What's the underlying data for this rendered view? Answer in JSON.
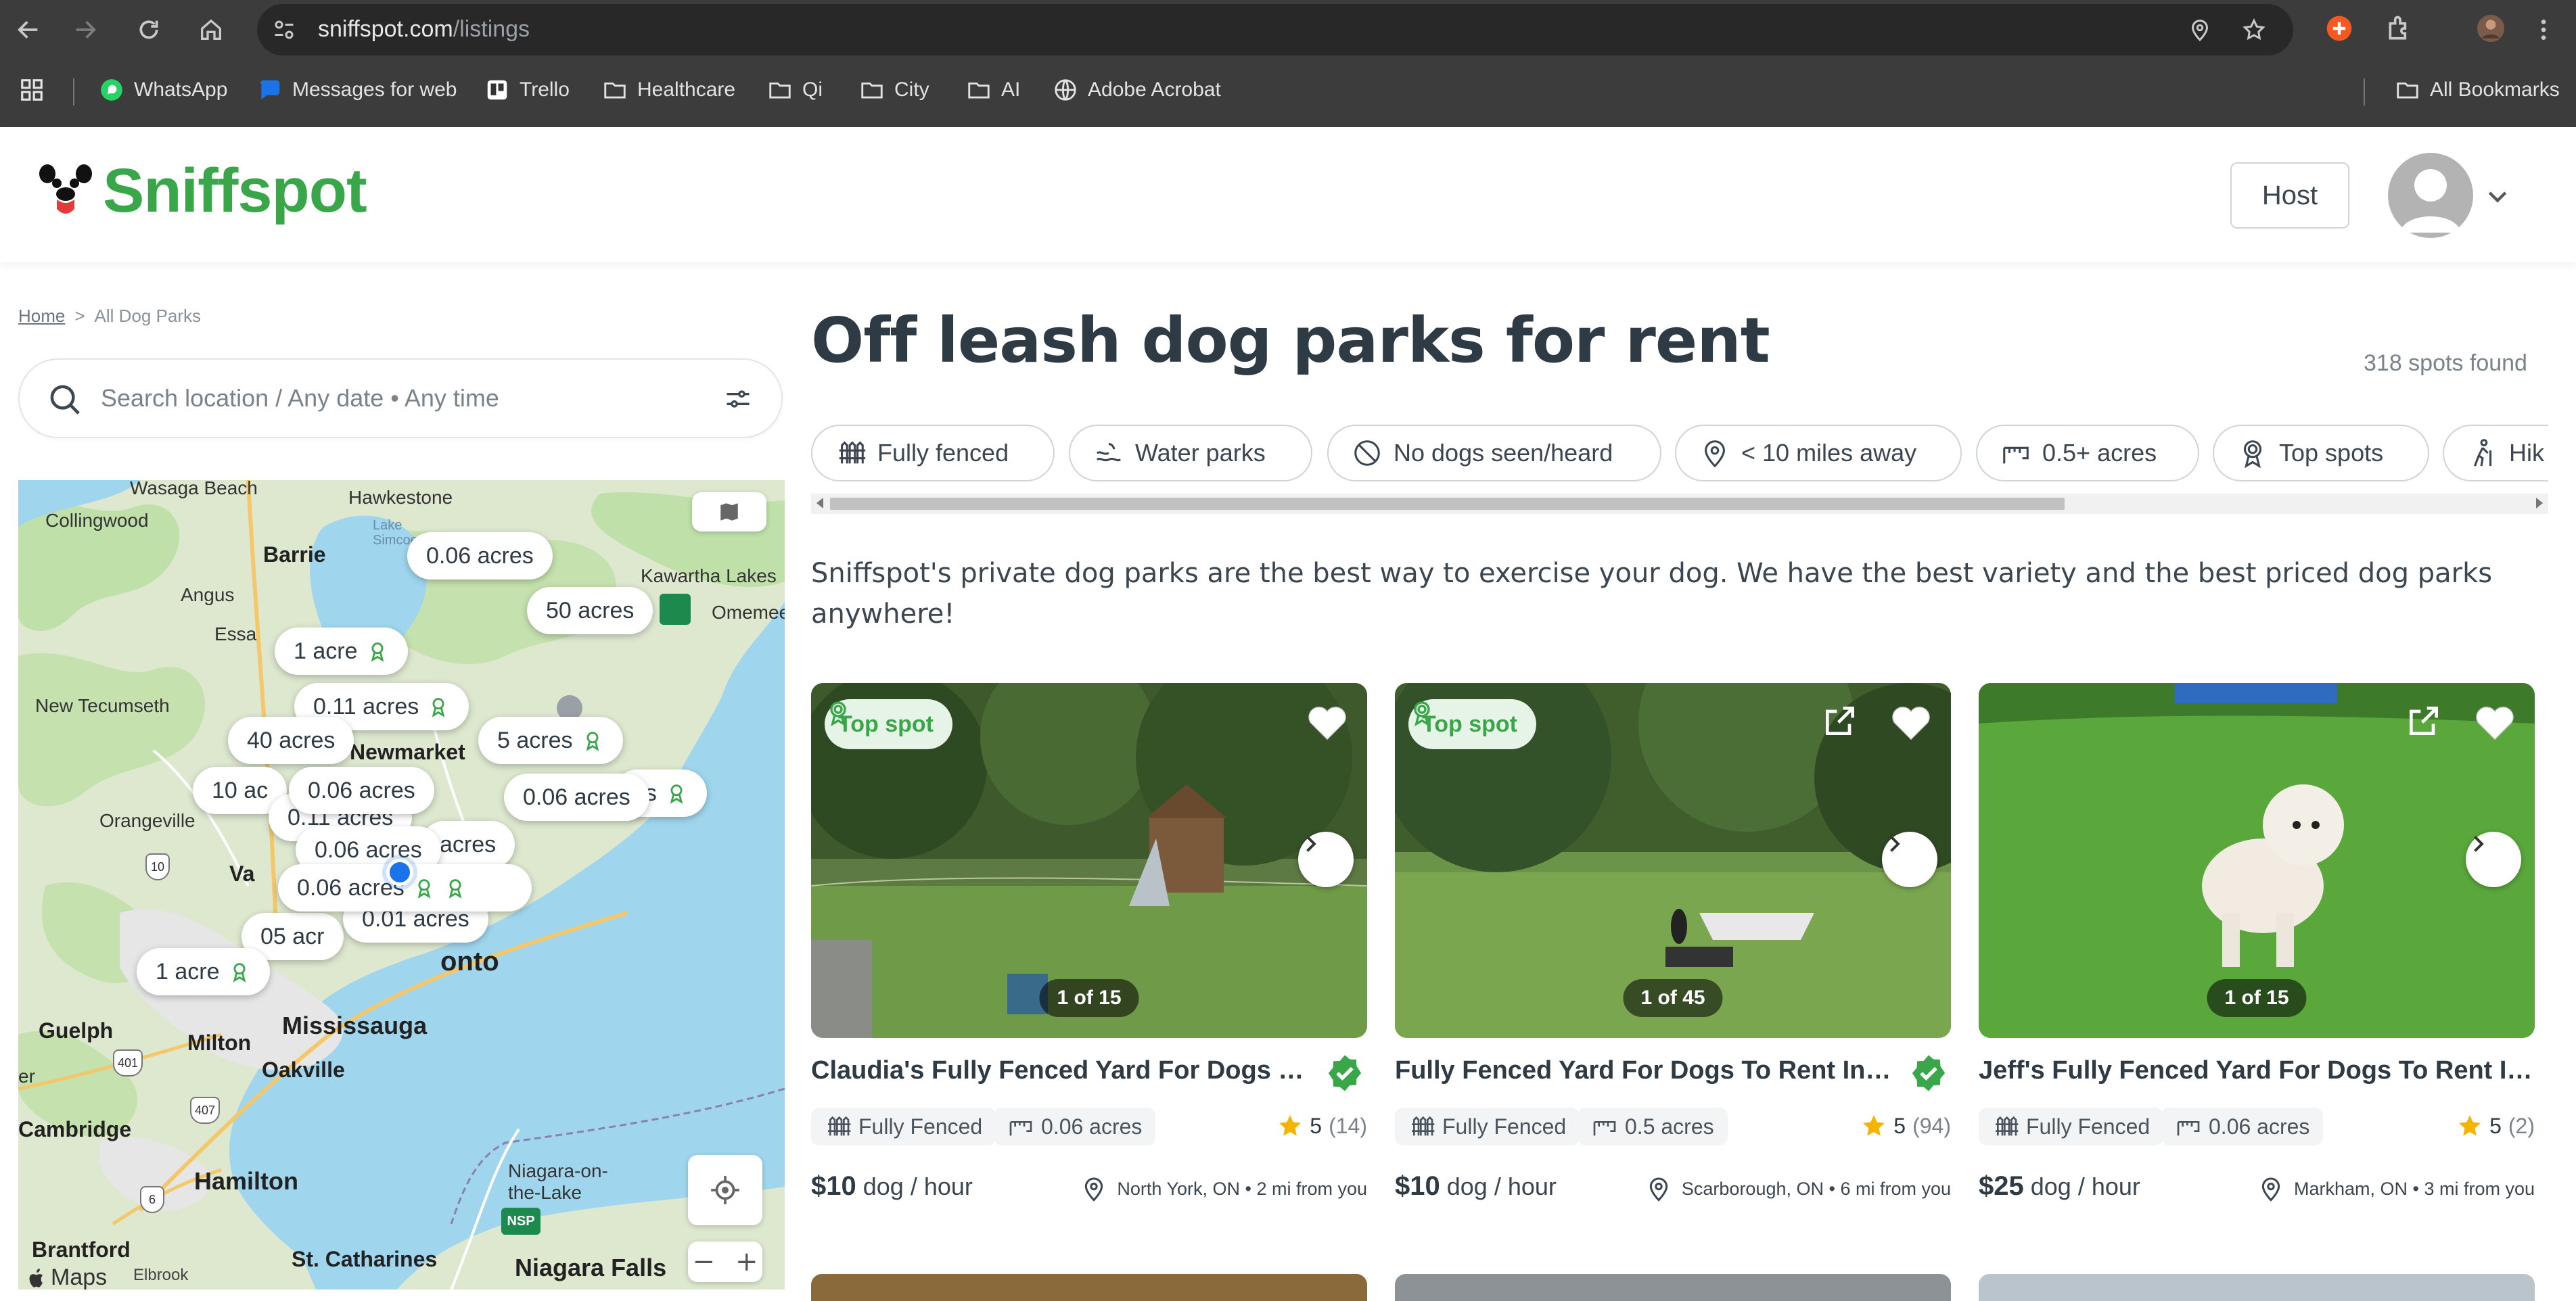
{
  "browser": {
    "url_domain": "sniffspot.com",
    "url_path": "/listings",
    "bookmarks": [
      {
        "label": "WhatsApp",
        "icon": "whatsapp-icon"
      },
      {
        "label": "Messages for web",
        "icon": "messages-icon"
      },
      {
        "label": "Trello",
        "icon": "trello-icon"
      },
      {
        "label": "Healthcare",
        "icon": "folder-icon"
      },
      {
        "label": "Qi",
        "icon": "folder-icon"
      },
      {
        "label": "City",
        "icon": "folder-icon"
      },
      {
        "label": "AI",
        "icon": "folder-icon"
      },
      {
        "label": "Adobe Acrobat",
        "icon": "globe-icon"
      }
    ],
    "all_bookmarks": "All Bookmarks"
  },
  "header": {
    "logo": "Sniffspot",
    "host_button": "Host"
  },
  "breadcrumb": {
    "home": "Home",
    "separator": ">",
    "current": "All Dog Parks"
  },
  "search": {
    "text": "Search location  /  Any date • Any time"
  },
  "map": {
    "pins": [
      "0.06 acres",
      "50 acres",
      "1 acre",
      "0.11 acres",
      "40 acres",
      "5 acres",
      "10 ac",
      "0.06 acres",
      "0.06 acres",
      "0.11 acres",
      "acres",
      "0.06 acres",
      "0.06 acres",
      "0.01 acres",
      "05 acr",
      "1 acre",
      "es"
    ],
    "cities": [
      "Wasaga Beach",
      "Hawkestone",
      "Collingwood",
      "Barrie",
      "Lake Simcoe",
      "Kawartha Lakes",
      "Omemee",
      "Angus",
      "Essa",
      "New Tecumseth",
      "Newmarket",
      "Orangeville",
      "Va",
      "Guelph",
      "Milton",
      "Mississauga",
      "onto",
      "Oakville",
      "Cambridge",
      "Hamilton",
      "Niagara-on-the-Lake",
      "Brantford",
      "St. Catharines",
      "Niagara Falls",
      "Maps",
      "er",
      "Elbrook"
    ],
    "highways": [
      "10",
      "401",
      "407",
      "6",
      "NSP"
    ]
  },
  "main": {
    "title": "Off leash dog parks for rent",
    "spots_found": "318 spots found",
    "filters": [
      {
        "label": "Fully fenced",
        "icon": "fence-icon"
      },
      {
        "label": "Water parks",
        "icon": "water-icon"
      },
      {
        "label": "No dogs seen/heard",
        "icon": "no-dogs-icon"
      },
      {
        "label": "< 10 miles away",
        "icon": "location-pin-icon"
      },
      {
        "label": "0.5+ acres",
        "icon": "ruler-icon"
      },
      {
        "label": "Top spots",
        "icon": "award-icon"
      },
      {
        "label": "Hik",
        "icon": "hiking-icon"
      }
    ],
    "intro": "Sniffspot's private dog parks are the best way to exercise your dog. We have the best variety and the best priced dog parks anywhere!"
  },
  "listings": [
    {
      "badge": "Top spot",
      "counter": "1 of 15",
      "title": "Claudia's Fully Fenced Yard For Dogs To R...",
      "fence": "Fully Fenced",
      "size": "0.06 acres",
      "rating": "5",
      "reviews": "(14)",
      "price": "$10",
      "unit": "dog / hour",
      "location": "North York, ON • 2 mi from you"
    },
    {
      "badge": "Top spot",
      "counter": "1 of 45",
      "title": "Fully Fenced Yard For Dogs To Rent In Sc...",
      "fence": "Fully Fenced",
      "size": "0.5 acres",
      "rating": "5",
      "reviews": "(94)",
      "price": "$10",
      "unit": "dog / hour",
      "location": "Scarborough, ON • 6 mi from you"
    },
    {
      "badge": "",
      "counter": "1 of 15",
      "title": "Jeff's Fully Fenced Yard For Dogs To Rent In M...",
      "fence": "Fully Fenced",
      "size": "0.06 acres",
      "rating": "5",
      "reviews": "(2)",
      "price": "$25",
      "unit": "dog / hour",
      "location": "Markham, ON • 3 mi from you"
    }
  ],
  "colors": {
    "brand_green": "#3aa64a",
    "chrome_dark": "#3c3c3c",
    "text": "#2e3a44"
  }
}
